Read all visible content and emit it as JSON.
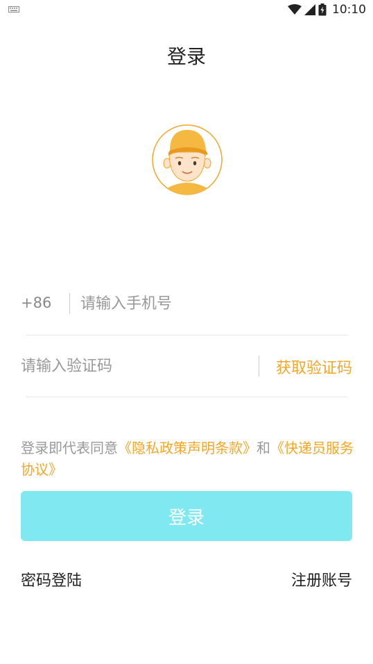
{
  "status_bar": {
    "time": "10:10",
    "icons": [
      "keyboard-icon",
      "wifi-icon",
      "signal-icon",
      "battery-icon"
    ]
  },
  "header": {
    "title": "登录"
  },
  "avatar": {
    "icon": "courier-avatar-icon"
  },
  "phone_field": {
    "country_code": "+86",
    "placeholder": "请输入手机号",
    "value": ""
  },
  "code_field": {
    "placeholder": "请输入验证码",
    "value": "",
    "get_code_label": "获取验证码"
  },
  "agreement": {
    "prefix": "登录即代表同意",
    "privacy_link": "《隐私政策声明条款》",
    "conjunction": "和",
    "service_link": "《快递员服务协议》"
  },
  "login_button": {
    "label": "登录"
  },
  "footer": {
    "password_login": "密码登陆",
    "register": "注册账号"
  },
  "colors": {
    "accent": "#F5A623",
    "button_bg": "#80E8F0",
    "text_primary": "#222222",
    "text_muted": "#999999"
  }
}
